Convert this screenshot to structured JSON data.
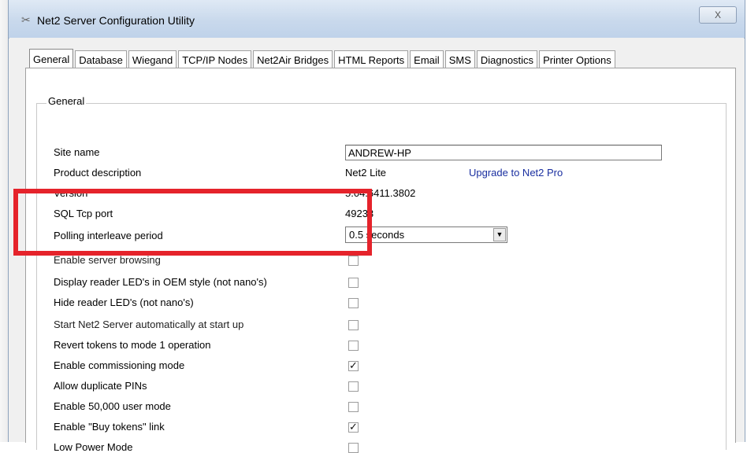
{
  "window": {
    "title": "Net2 Server Configuration Utility",
    "close_glyph": "X"
  },
  "tabs": [
    {
      "label": "General",
      "active": true
    },
    {
      "label": "Database"
    },
    {
      "label": "Wiegand"
    },
    {
      "label": "TCP/IP Nodes"
    },
    {
      "label": "Net2Air Bridges"
    },
    {
      "label": "HTML Reports"
    },
    {
      "label": "Email"
    },
    {
      "label": "SMS"
    },
    {
      "label": "Diagnostics"
    },
    {
      "label": "Printer Options"
    }
  ],
  "general": {
    "group_title": "General",
    "site_name_label": "Site name",
    "site_name_value": "ANDREW-HP",
    "product_label": "Product description",
    "product_value": "Net2 Lite",
    "upgrade_link": "Upgrade to Net2 Pro",
    "version_label": "Version",
    "version_value": "5.04.6411.3802",
    "sql_port_label": "SQL Tcp port",
    "sql_port_value": "49233",
    "polling_label": "Polling interleave period",
    "polling_value": "0.5 seconds"
  },
  "options": [
    {
      "label": "Enable server browsing",
      "checked": false
    },
    {
      "label": "Display reader LED's in OEM style (not nano's)",
      "checked": false
    },
    {
      "label": "Hide reader LED's (not nano's)",
      "checked": false
    },
    {
      "label": "Start Net2 Server automatically at start up",
      "checked": false
    },
    {
      "label": "Revert tokens to mode 1 operation",
      "checked": false
    },
    {
      "label": "Enable commissioning mode",
      "checked": true
    },
    {
      "label": "Allow duplicate PINs",
      "checked": false
    },
    {
      "label": "Enable 50,000 user mode",
      "checked": false
    },
    {
      "label": "Enable \"Buy tokens\" link",
      "checked": true
    },
    {
      "label": "Low Power Mode",
      "checked": false
    }
  ],
  "colors": {
    "highlight": "#e5232b",
    "link": "#1a2fa0"
  }
}
